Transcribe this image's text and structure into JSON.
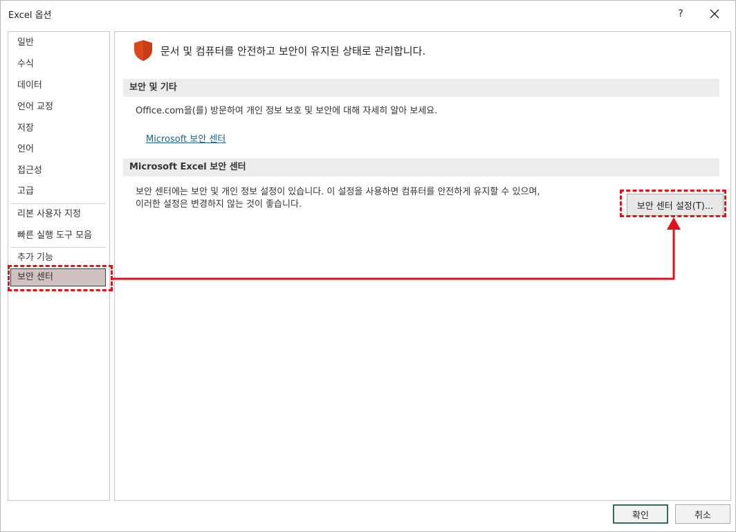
{
  "window": {
    "title": "Excel 옵션",
    "help_label": "?",
    "close_icon": "close-icon"
  },
  "sidebar": {
    "items": [
      {
        "label": "일반"
      },
      {
        "label": "수식"
      },
      {
        "label": "데이터"
      },
      {
        "label": "언어 교정"
      },
      {
        "label": "저장"
      },
      {
        "label": "언어"
      },
      {
        "label": "접근성"
      },
      {
        "label": "고급"
      },
      {
        "label": "리본 사용자 지정"
      },
      {
        "label": "빠른 실행 도구 모음"
      },
      {
        "label": "추가 기능"
      },
      {
        "label": "보안 센터",
        "selected": true
      }
    ]
  },
  "main": {
    "header_icon": "shield-icon",
    "header_text": "문서 및 컴퓨터를 안전하고 보안이 유지된 상태로 관리합니다.",
    "section1": {
      "title": "보안 및 기타",
      "description": "Office.com을(를) 방문하여 개인 정보 보호 및 보안에 대해 자세히 알아 보세요.",
      "link": "Microsoft 보안 센터"
    },
    "section2": {
      "title": "Microsoft Excel 보안 센터",
      "description_line1": "보안 센터에는 보안 및 개인 정보 설정이 있습니다. 이 설정을 사용하면 컴퓨터를 안전하게 유지할 수 있으며,",
      "description_line2": "이러한 설정은 변경하지 않는 것이 좋습니다.",
      "button": "보안 센터 설정(T)..."
    }
  },
  "footer": {
    "ok": "확인",
    "cancel": "취소"
  },
  "colors": {
    "annotation": "#e0111b",
    "shield": "#d9481c",
    "selected_bg": "#d0c2c0",
    "link": "#1f5f8b"
  }
}
